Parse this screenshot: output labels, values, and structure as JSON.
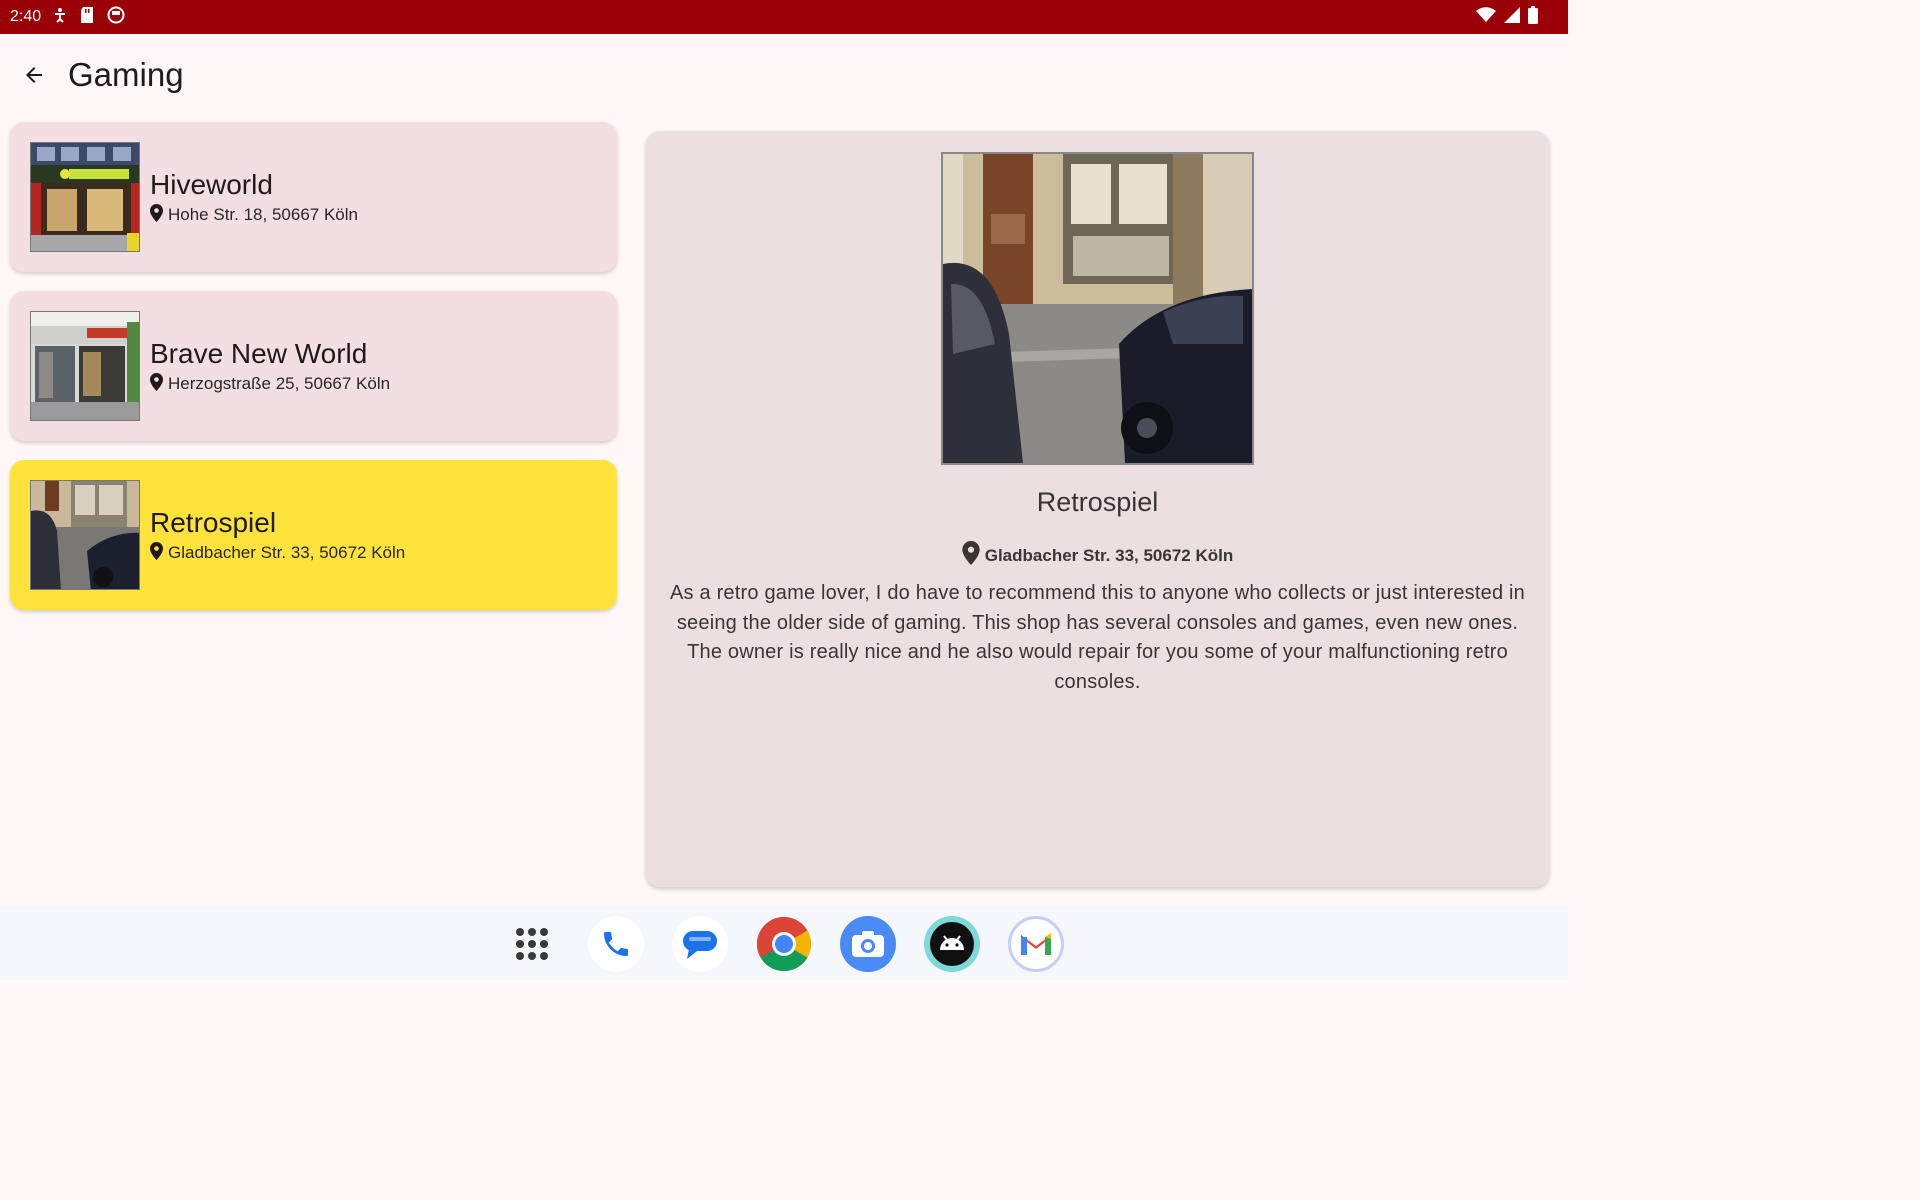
{
  "status_bar": {
    "time": "2:40"
  },
  "app_bar": {
    "title": "Gaming"
  },
  "places": [
    {
      "name": "Hiveworld",
      "address": "Hohe Str. 18, 50667 Köln",
      "selected": false
    },
    {
      "name": "Brave New World",
      "address": "Herzogstraße 25, 50667 Köln",
      "selected": false
    },
    {
      "name": "Retrospiel",
      "address": "Gladbacher Str. 33, 50672 Köln",
      "selected": true
    }
  ],
  "detail": {
    "name": "Retrospiel",
    "address": "Gladbacher Str. 33, 50672 Köln",
    "description": "As a retro game lover, I do have to recommend this to anyone who collects or just interested in seeing the older side of gaming. This shop has several consoles and games, even new ones. The owner is really nice and he also would repair for you some of your malfunctioning retro consoles."
  },
  "colors": {
    "status_bar": "#990008",
    "selected_card": "#ffe33d",
    "card": "#f3dfe1",
    "detail_panel": "#ecdfe1"
  },
  "dock": [
    "app-drawer-icon",
    "phone-icon",
    "messages-icon",
    "chrome-icon",
    "camera-icon",
    "android-icon",
    "gmail-icon"
  ]
}
